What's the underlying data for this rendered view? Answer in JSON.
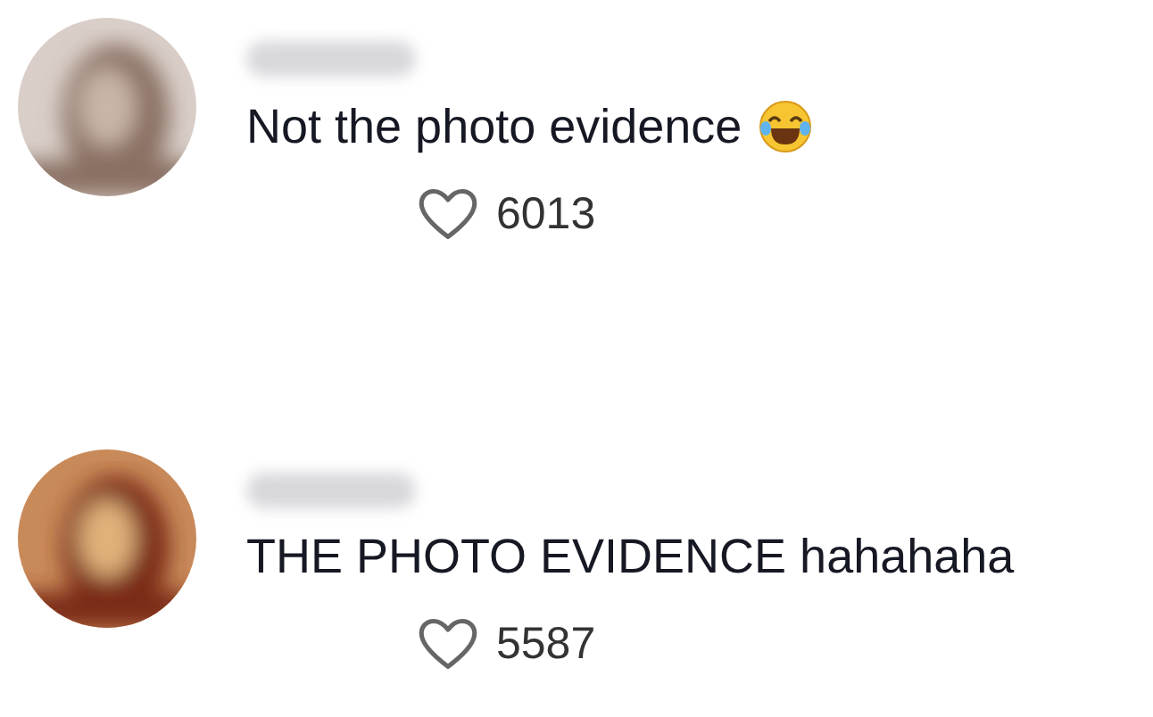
{
  "comments": [
    {
      "text": "Not the photo evidence",
      "emoji": true,
      "likes": "6013"
    },
    {
      "text": "THE PHOTO EVIDENCE hahahaha",
      "emoji": false,
      "likes": "5587"
    }
  ]
}
